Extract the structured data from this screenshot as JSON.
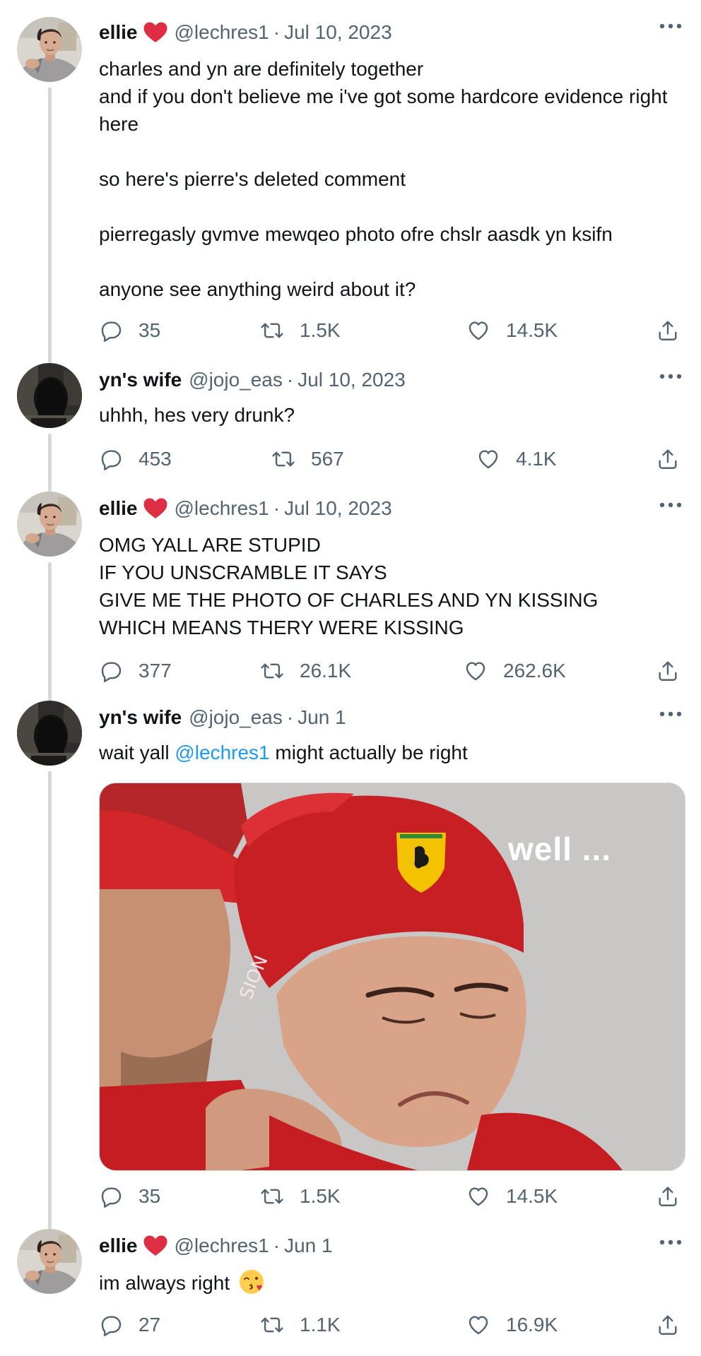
{
  "colors": {
    "text": "#0f1419",
    "secondary": "#536471",
    "link": "#1d9bf0",
    "thread_line": "#cfd9de",
    "heart_badge": "#e0245e"
  },
  "tweets": [
    {
      "name": "ellie",
      "badge_icon": "red-heart-icon",
      "handle": "@lechres1",
      "dot": "·",
      "date": "Jul 10, 2023",
      "text": "charles and yn are definitely together\nand if you don't believe me i've got some hardcore evidence right here\n\nso here's pierre's deleted comment\n\npierregasly gvmve mewqeo photo ofre chslr aasdk yn ksifn\n\nanyone see anything weird about it?",
      "replies": "35",
      "retweets": "1.5K",
      "likes": "14.5K"
    },
    {
      "name": "yn's wife",
      "handle": "@jojo_eas",
      "dot": "·",
      "date": "Jul 10, 2023",
      "text": "uhhh, hes very drunk?",
      "replies": "453",
      "retweets": "567",
      "likes": "4.1K"
    },
    {
      "name": "ellie",
      "badge_icon": "red-heart-icon",
      "handle": "@lechres1",
      "dot": "·",
      "date": "Jul 10, 2023",
      "text": "OMG YALL ARE STUPID\nIF YOU UNSCRAMBLE IT SAYS\nGIVE ME THE PHOTO OF CHARLES AND YN KISSING\nWHICH MEANS THERY WERE KISSING",
      "replies": "377",
      "retweets": "26.1K",
      "likes": "262.6K"
    },
    {
      "name": "yn's wife",
      "handle": "@jojo_eas",
      "dot": "·",
      "date": "Jun 1",
      "text_before": "wait yall ",
      "mention": "@lechres1",
      "text_after": " might actually be right",
      "media_caption": "well ...",
      "replies": "35",
      "retweets": "1.5K",
      "likes": "14.5K"
    },
    {
      "name": "ellie",
      "badge_icon": "red-heart-icon",
      "handle": "@lechres1",
      "dot": "·",
      "date": "Jun 1",
      "text": "im always right ",
      "emoji_icon": "kissing-face-icon",
      "replies": "27",
      "retweets": "1.1K",
      "likes": "16.9K"
    }
  ]
}
